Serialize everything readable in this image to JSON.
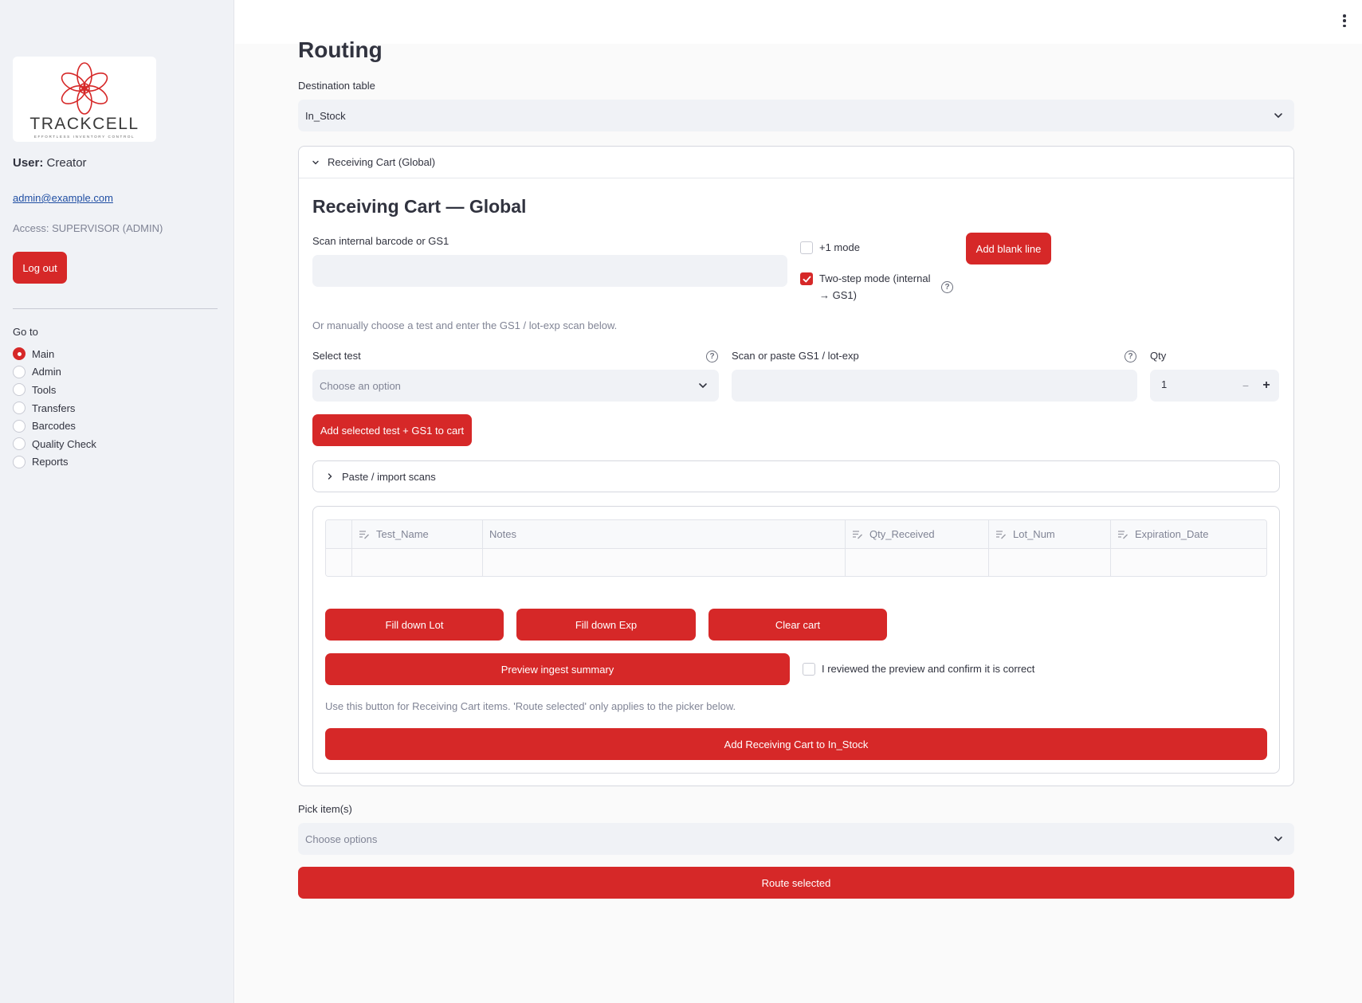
{
  "sidebar": {
    "logo_text": "TRACKCELL",
    "logo_tagline": "EFFORTLESS INVENTORY CONTROL",
    "user_label": "User:",
    "user_name": "Creator",
    "email": "admin@example.com",
    "access": "Access: SUPERVISOR (ADMIN)",
    "logout_label": "Log out",
    "goto_label": "Go to",
    "nav": [
      {
        "label": "Main",
        "selected": true
      },
      {
        "label": "Admin",
        "selected": false
      },
      {
        "label": "Tools",
        "selected": false
      },
      {
        "label": "Transfers",
        "selected": false
      },
      {
        "label": "Barcodes",
        "selected": false
      },
      {
        "label": "Quality Check",
        "selected": false
      },
      {
        "label": "Reports",
        "selected": false
      }
    ]
  },
  "main": {
    "title": "Routing",
    "destination_label": "Destination table",
    "destination_value": "In_Stock",
    "expander_title": "Receiving Cart (Global)",
    "cart_heading": "Receiving Cart — Global",
    "scan_label": "Scan internal barcode or GS1",
    "plus_one_label": "+1 mode",
    "plus_one_checked": false,
    "two_step_label_1": "Two-step mode (internal",
    "two_step_label_2": "→ GS1)",
    "two_step_checked": true,
    "add_blank_label": "Add blank line",
    "manual_hint": "Or manually choose a test and enter the GS1 / lot-exp scan below.",
    "select_test_label": "Select test",
    "select_test_placeholder": "Choose an option",
    "gs1_label": "Scan or paste GS1 / lot-exp",
    "qty_label": "Qty",
    "qty_value": "1",
    "add_selected_label": "Add selected test + GS1 to cart",
    "paste_import_label": "Paste / import scans",
    "table_columns": [
      "Test_Name",
      "Notes",
      "Qty_Received",
      "Lot_Num",
      "Expiration_Date"
    ],
    "fill_lot_label": "Fill down Lot",
    "fill_exp_label": "Fill down Exp",
    "clear_cart_label": "Clear cart",
    "preview_label": "Preview ingest summary",
    "confirm_label": "I reviewed the preview and confirm it is correct",
    "confirm_checked": false,
    "route_hint": "Use this button for Receiving Cart items. 'Route selected' only applies to the picker below.",
    "add_cart_label": "Add Receiving Cart to In_Stock",
    "pick_label": "Pick item(s)",
    "pick_placeholder": "Choose options",
    "route_selected_label": "Route selected"
  },
  "colors": {
    "accent": "#d62828",
    "sidebar_bg": "#f0f2f6",
    "input_bg": "#f0f2f6",
    "text": "#31333f",
    "muted": "#808495"
  }
}
